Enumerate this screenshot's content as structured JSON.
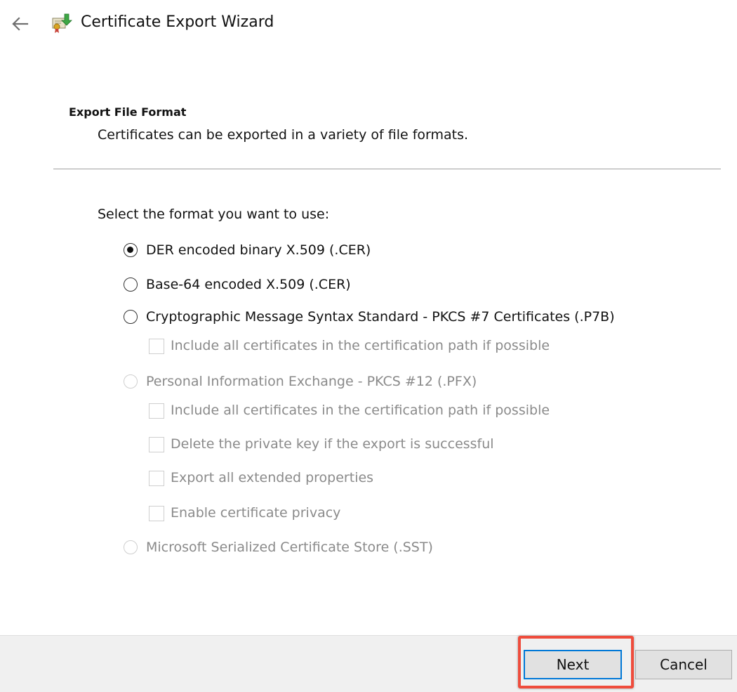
{
  "window": {
    "title": "Certificate Export Wizard",
    "back_icon": "back-arrow-icon",
    "app_icon": "certificate-icon"
  },
  "header": {
    "section_title": "Export File Format",
    "section_description": "Certificates can be exported in a variety of file formats."
  },
  "body": {
    "prompt": "Select the format you want to use:",
    "options": [
      {
        "label": "DER encoded binary X.509 (.CER)",
        "checked": true,
        "enabled": true
      },
      {
        "label": "Base-64 encoded X.509 (.CER)",
        "checked": false,
        "enabled": true
      },
      {
        "label": "Cryptographic Message Syntax Standard - PKCS #7 Certificates (.P7B)",
        "checked": false,
        "enabled": true
      },
      {
        "label": "Personal Information Exchange - PKCS #12 (.PFX)",
        "checked": false,
        "enabled": false
      },
      {
        "label": "Microsoft Serialized Certificate Store (.SST)",
        "checked": false,
        "enabled": false
      }
    ],
    "p7b_suboptions": [
      {
        "label": "Include all certificates in the certification path if possible",
        "checked": false,
        "enabled": false
      }
    ],
    "pfx_suboptions": [
      {
        "label": "Include all certificates in the certification path if possible",
        "checked": false,
        "enabled": false
      },
      {
        "label": "Delete the private key if the export is successful",
        "checked": false,
        "enabled": false
      },
      {
        "label": "Export all extended properties",
        "checked": false,
        "enabled": false
      },
      {
        "label": "Enable certificate privacy",
        "checked": false,
        "enabled": false
      }
    ]
  },
  "footer": {
    "next_label": "Next",
    "cancel_label": "Cancel"
  },
  "colors": {
    "focus_border": "#0078d7",
    "highlight_annotation": "#ef4c3c",
    "disabled_text": "#8a8a8a"
  }
}
